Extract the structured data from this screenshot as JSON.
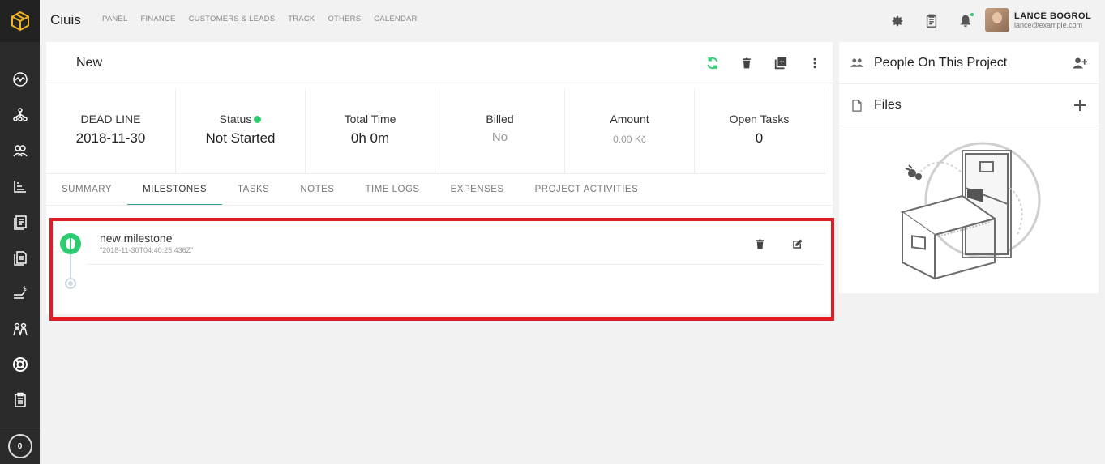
{
  "app": {
    "brand": "Ciuis"
  },
  "topnav": {
    "items": [
      "PANEL",
      "FINANCE",
      "CUSTOMERS & LEADS",
      "TRACK",
      "OTHERS",
      "CALENDAR"
    ]
  },
  "user": {
    "name": "LANCE BOGROL",
    "email": "lance@example.com"
  },
  "sidebar": {
    "icons": [
      "activity-icon",
      "org-chart-icon",
      "customers-icon",
      "projects-icon",
      "invoices-icon",
      "documents-icon",
      "expenses-icon",
      "staff-icon",
      "support-icon",
      "clipboard-icon"
    ],
    "counter": "0"
  },
  "project": {
    "title": "New"
  },
  "stats": [
    {
      "label": "DEAD LINE",
      "value": "2018-11-30"
    },
    {
      "label": "Status",
      "value": "Not Started"
    },
    {
      "label": "Total Time",
      "value": "0h 0m"
    },
    {
      "label": "Billed",
      "value": "No"
    },
    {
      "label": "Amount",
      "value": "0.00 Kč"
    },
    {
      "label": "Open Tasks",
      "value": "0"
    }
  ],
  "tabs": [
    "SUMMARY",
    "MILESTONES",
    "TASKS",
    "NOTES",
    "TIME LOGS",
    "EXPENSES",
    "PROJECT ACTIVITIES"
  ],
  "active_tab": "MILESTONES",
  "milestone": {
    "title": "new milestone",
    "date": "\"2018-11-30T04:40:25.436Z\""
  },
  "right_panel": {
    "people_label": "People On This Project",
    "files_label": "Files"
  },
  "colors": {
    "accent": "#2ecc71",
    "highlight": "#e31b23",
    "sidebar": "#2b2b2b",
    "tab_underline": "#26a69a",
    "logo": "#f0b323"
  }
}
